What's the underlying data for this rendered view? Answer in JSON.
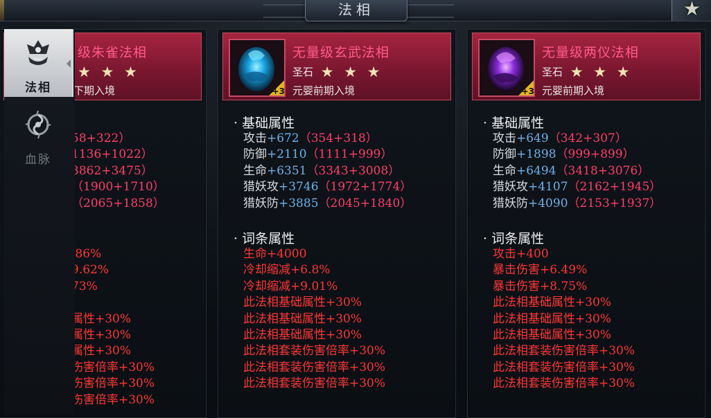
{
  "header": {
    "title": "法相"
  },
  "sidebar": {
    "tabs": [
      {
        "label": "法相",
        "icon": "faxiang-crown-icon",
        "active": true
      },
      {
        "label": "血脉",
        "icon": "xuemai-swirl-icon",
        "active": false
      }
    ]
  },
  "section_titles": {
    "base": "· 基础属性",
    "affix": "· 词条属性"
  },
  "cards": [
    {
      "name": "级朱雀法相",
      "stars": "★ ★ ★",
      "stage": "下期入境",
      "stats": [
        {
          "text": "58+322）"
        },
        {
          "text": "1136+1022）"
        },
        {
          "text": "3862+3475）"
        },
        {
          "text": "（1900+1710）"
        },
        {
          "text": "（2065+1858）"
        }
      ],
      "affixes": [
        ".86%",
        "9.62%",
        "73%",
        "",
        "属性+30%",
        "属性+30%",
        "属性+30%",
        "伤害倍率+30%",
        "伤害倍率+30%",
        "伤害倍率+30%"
      ]
    },
    {
      "name": "无量级玄武法相",
      "grade": "圣石",
      "stars": "★ ★ ★",
      "stage": "元婴前期入境",
      "badge": "+3",
      "egg_color": "#2ec5ff",
      "stats": [
        {
          "key": "攻击",
          "val": "+672",
          "paren": "（354+318）"
        },
        {
          "key": "防御",
          "val": "+2110",
          "paren": "（1111+999）"
        },
        {
          "key": "生命",
          "val": "+6351",
          "paren": "（3343+3008）"
        },
        {
          "key": "猎妖攻",
          "val": "+3746",
          "paren": "（1972+1774）"
        },
        {
          "key": "猎妖防",
          "val": "+3885",
          "paren": "（2045+1840）"
        }
      ],
      "affixes": [
        "生命+4000",
        "冷却缩减+6.8%",
        "冷却缩减+9.01%",
        "此法相基础属性+30%",
        "此法相基础属性+30%",
        "此法相基础属性+30%",
        "此法相套装伤害倍率+30%",
        "此法相套装伤害倍率+30%",
        "此法相套装伤害倍率+30%"
      ]
    },
    {
      "name": "无量级两仪法相",
      "grade": "圣石",
      "stars": "★ ★ ★",
      "stage": "元婴前期入境",
      "badge": "+3",
      "egg_color": "#b04bff",
      "stats": [
        {
          "key": "攻击",
          "val": "+649",
          "paren": "（342+307）"
        },
        {
          "key": "防御",
          "val": "+1898",
          "paren": "（999+899）"
        },
        {
          "key": "生命",
          "val": "+6494",
          "paren": "（3418+3076）"
        },
        {
          "key": "猎妖攻",
          "val": "+4107",
          "paren": "（2162+1945）"
        },
        {
          "key": "猎妖防",
          "val": "+4090",
          "paren": "（2153+1937）"
        }
      ],
      "affixes": [
        "攻击+400",
        "暴击伤害+6.49%",
        "暴击伤害+8.75%",
        "此法相基础属性+30%",
        "此法相基础属性+30%",
        "此法相基础属性+30%",
        "此法相套装伤害倍率+30%",
        "此法相套装伤害倍率+30%",
        "此法相套装伤害倍率+30%"
      ]
    }
  ]
}
